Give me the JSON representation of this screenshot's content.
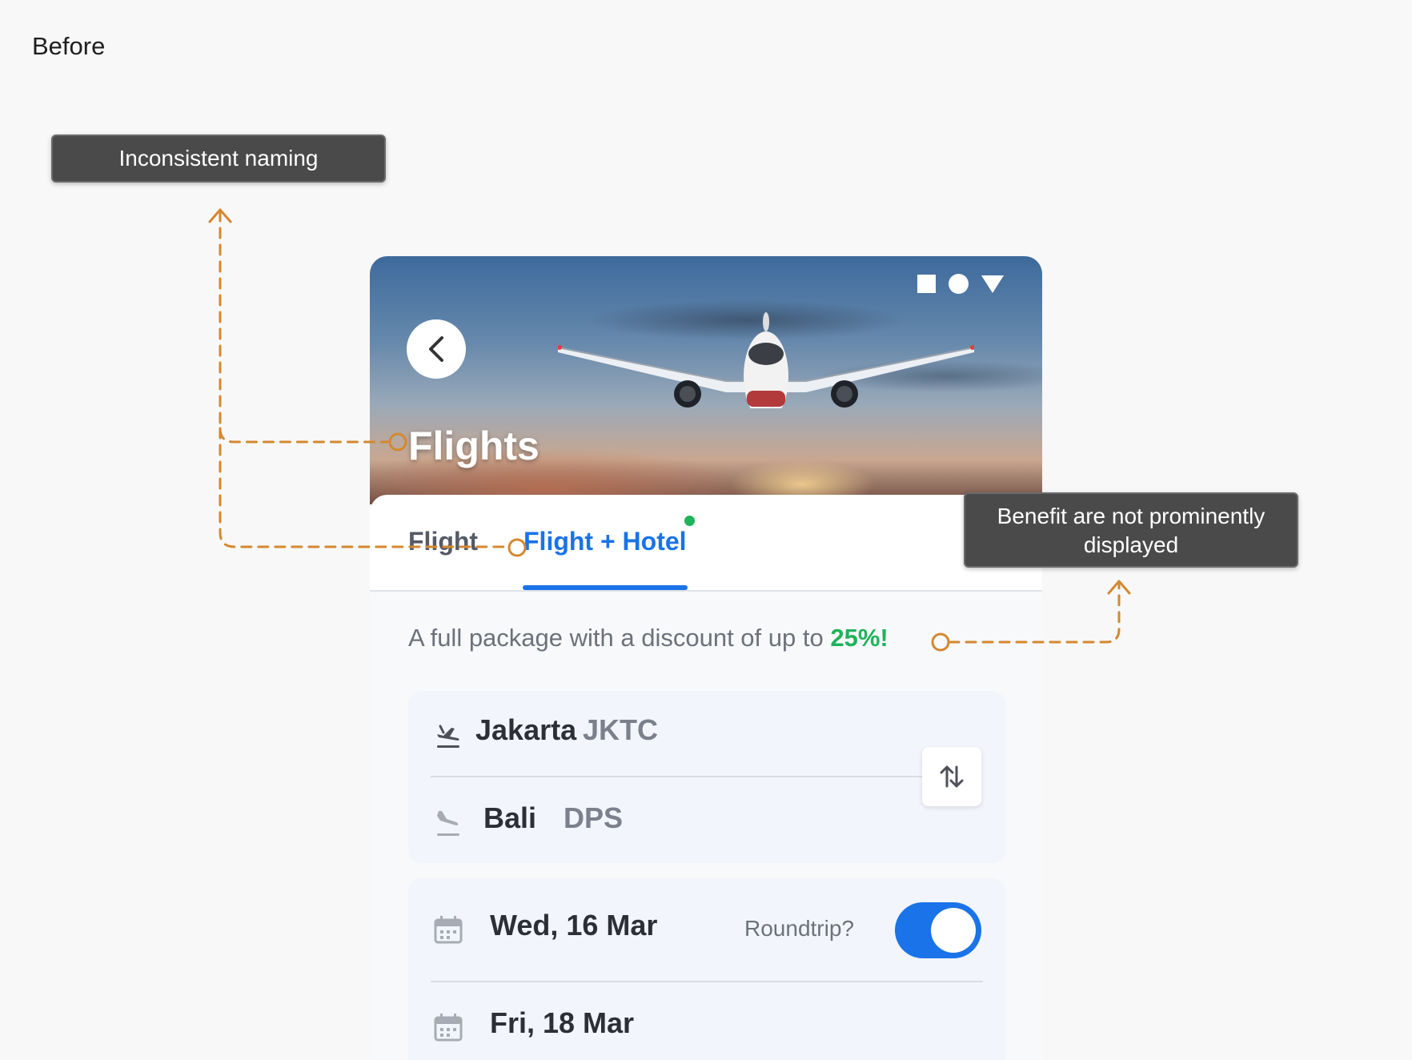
{
  "section_label": "Before",
  "annotations": {
    "naming": "Inconsistent naming",
    "benefit": "Benefit are not prominently displayed"
  },
  "app": {
    "page_title": "Flights",
    "tabs": [
      {
        "label": "Flight",
        "selected": false
      },
      {
        "label": "Flight + Hotel",
        "selected": true
      }
    ],
    "promo": {
      "text": "A full package with a discount of up to ",
      "highlight": "25%!"
    },
    "route": {
      "origin": {
        "city": "Jakarta",
        "code": "JKTC"
      },
      "destination": {
        "city": "Bali",
        "code": "DPS"
      }
    },
    "dates": {
      "depart": "Wed, 16 Mar",
      "return": "Fri, 18 Mar",
      "roundtrip_label": "Roundtrip?",
      "roundtrip_on": true
    }
  },
  "colors": {
    "accent": "#1a73e8",
    "discount": "#1fb35a",
    "annotation_line": "#d4882f",
    "annotation_box": "#4a4a4a"
  }
}
